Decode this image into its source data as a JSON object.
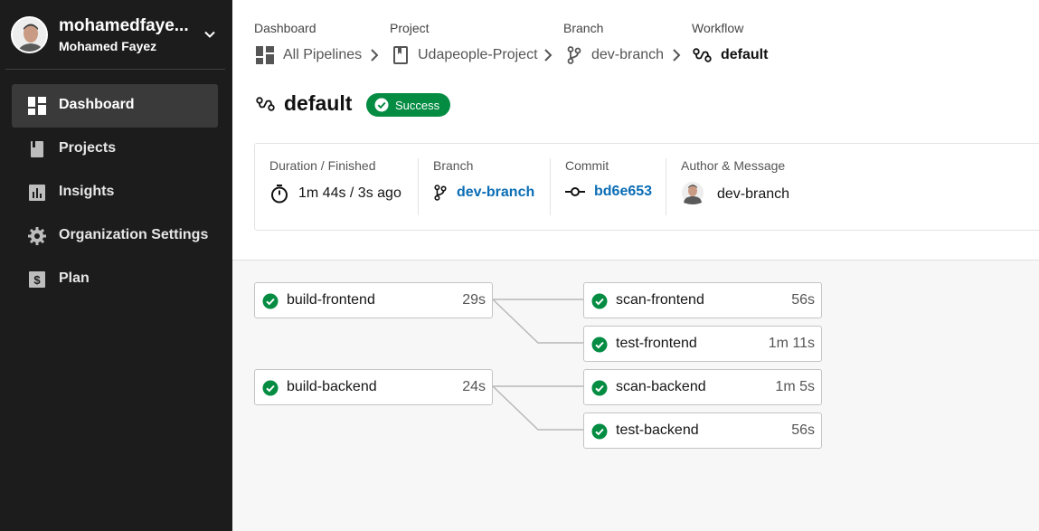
{
  "user": {
    "username": "mohamedfaye...",
    "full_name": "Mohamed Fayez"
  },
  "nav": [
    {
      "label": "Dashboard",
      "icon": "dashboard-icon",
      "active": true
    },
    {
      "label": "Projects",
      "icon": "projects-icon"
    },
    {
      "label": "Insights",
      "icon": "insights-icon"
    },
    {
      "label": "Organization Settings",
      "icon": "gear-icon"
    },
    {
      "label": "Plan",
      "icon": "dollar-icon"
    }
  ],
  "breadcrumbs": [
    {
      "heading": "Dashboard",
      "label": "All Pipelines",
      "icon": "pipelines-icon"
    },
    {
      "heading": "Project",
      "label": "Udapeople-Project",
      "icon": "bookmark-icon"
    },
    {
      "heading": "Branch",
      "label": "dev-branch",
      "icon": "branch-icon"
    },
    {
      "heading": "Workflow",
      "label": "default",
      "icon": "workflow-icon"
    }
  ],
  "workflow": {
    "name": "default",
    "status": "Success",
    "status_color": "#048c43"
  },
  "meta": {
    "duration_heading": "Duration / Finished",
    "duration": "1m 44s / 3s ago",
    "branch_heading": "Branch",
    "branch": "dev-branch",
    "commit_heading": "Commit",
    "commit": "bd6e653",
    "author_heading": "Author & Message",
    "message": "dev-branch"
  },
  "jobs": [
    {
      "name": "build-frontend",
      "duration": "29s"
    },
    {
      "name": "scan-frontend",
      "duration": "56s"
    },
    {
      "name": "test-frontend",
      "duration": "1m 11s"
    },
    {
      "name": "build-backend",
      "duration": "24s"
    },
    {
      "name": "scan-backend",
      "duration": "1m 5s"
    },
    {
      "name": "test-backend",
      "duration": "56s"
    }
  ]
}
